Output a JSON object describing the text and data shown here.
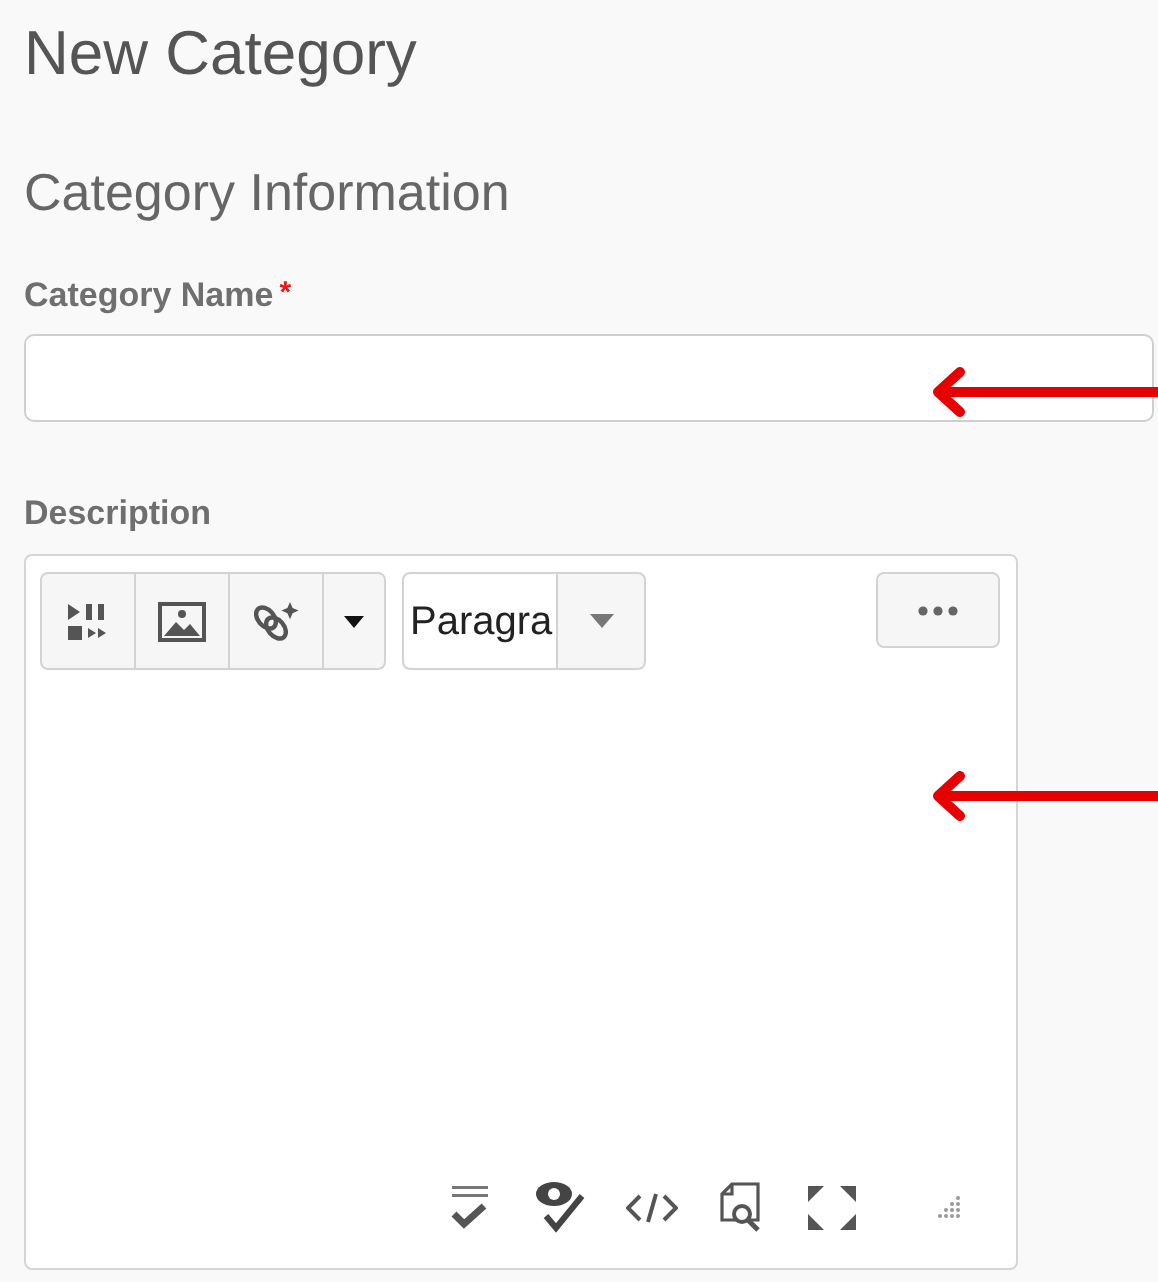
{
  "page_title": "New Category",
  "section_title": "Category Information",
  "name_field": {
    "label": "Category Name",
    "required_mark": "*"
  },
  "description_field": {
    "label": "Description",
    "editor": {
      "format_select": "Paragra"
    }
  }
}
